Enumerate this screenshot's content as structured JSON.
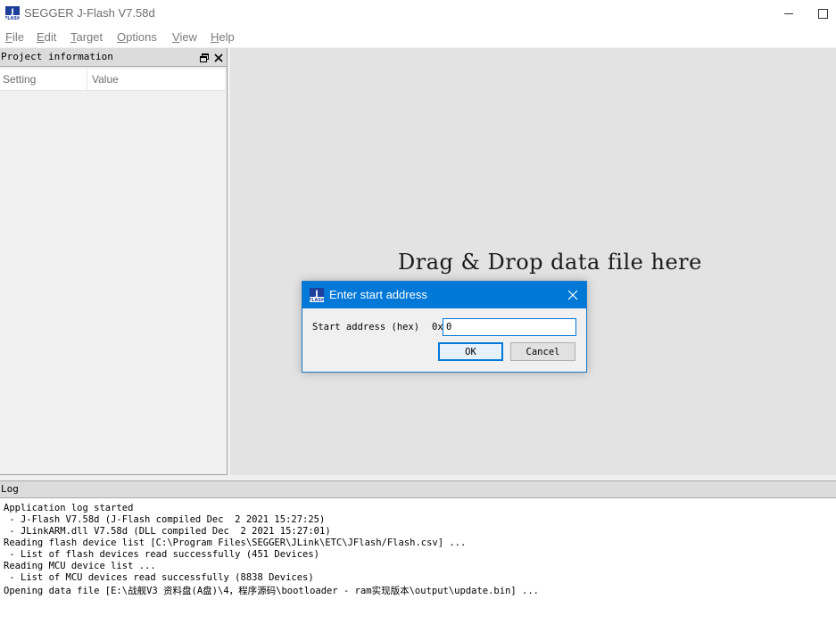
{
  "window": {
    "title": "SEGGER J-Flash V7.58d",
    "icon": "j-flash-icon"
  },
  "menu": [
    {
      "label": "File"
    },
    {
      "label": "Edit"
    },
    {
      "label": "Target"
    },
    {
      "label": "Options"
    },
    {
      "label": "View"
    },
    {
      "label": "Help"
    }
  ],
  "project_panel": {
    "title": "Project information",
    "columns": {
      "setting": "Setting",
      "value": "Value"
    }
  },
  "drop_area": {
    "text": "Drag & Drop data file here"
  },
  "log_panel": {
    "title": "Log",
    "lines": [
      "Application log started",
      " - J-Flash V7.58d (J-Flash compiled Dec  2 2021 15:27:25)",
      " - JLinkARM.dll V7.58d (DLL compiled Dec  2 2021 15:27:01)",
      "Reading flash device list [C:\\Program Files\\SEGGER\\JLink\\ETC\\JFlash/Flash.csv] ...",
      " - List of flash devices read successfully (451 Devices)",
      "Reading MCU device list ...",
      " - List of MCU devices read successfully (8838 Devices)",
      "Opening data file [E:\\战舰V3 资料盘(A盘)\\4，程序源码\\bootloader - ram实现版本\\output\\update.bin] ..."
    ]
  },
  "dialog": {
    "title": "Enter start address",
    "label": "Start address (hex)",
    "prefix": "0x",
    "value": "0",
    "ok_label": "OK",
    "cancel_label": "Cancel"
  },
  "colors": {
    "accent": "#0078d7",
    "drop_area_bg": "#e3e3e3",
    "panel_header_bg": "#dcdcdc"
  }
}
